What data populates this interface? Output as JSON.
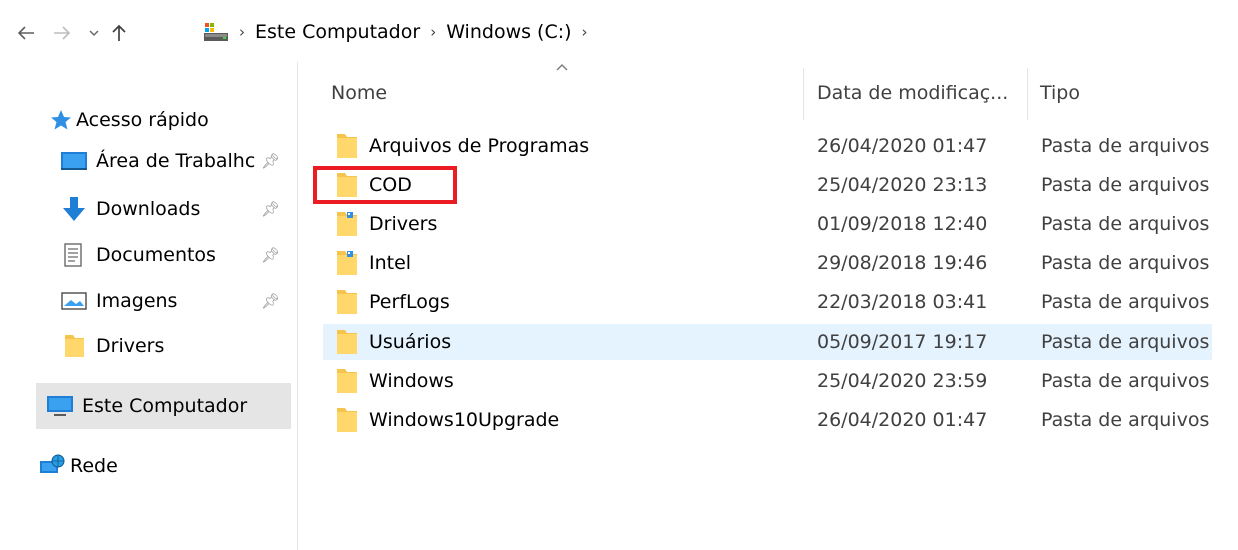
{
  "toolbar": {
    "back_icon": "arrow-left-icon",
    "forward_icon": "arrow-right-icon",
    "recent_icon": "chevron-down-icon",
    "up_icon": "arrow-up-icon"
  },
  "breadcrumb": {
    "root_icon": "computer-drive-icon",
    "items": [
      "Este Computador",
      "Windows (C:)"
    ],
    "separator": "›"
  },
  "sidebar": {
    "quick_access": "Acesso rápido",
    "items": [
      {
        "label": "Área de Trabalhc",
        "icon": "desktop-icon",
        "pinned": true
      },
      {
        "label": "Downloads",
        "icon": "download-arrow-icon",
        "pinned": true
      },
      {
        "label": "Documentos",
        "icon": "document-icon",
        "pinned": true
      },
      {
        "label": "Imagens",
        "icon": "pictures-icon",
        "pinned": true
      },
      {
        "label": "Drivers",
        "icon": "folder-icon",
        "pinned": false
      }
    ],
    "this_pc": "Este Computador",
    "network": "Rede"
  },
  "columns": {
    "name": "Nome",
    "date": "Data de modificaç...",
    "type": "Tipo",
    "sort_indicator": "^"
  },
  "files": [
    {
      "name": "Arquivos de Programas",
      "date": "26/04/2020 01:47",
      "type": "Pasta de arquivos"
    },
    {
      "name": "COD",
      "date": "25/04/2020 23:13",
      "type": "Pasta de arquivos"
    },
    {
      "name": "Drivers",
      "date": "01/09/2018 12:40",
      "type": "Pasta de arquivos"
    },
    {
      "name": "Intel",
      "date": "29/08/2018 19:46",
      "type": "Pasta de arquivos"
    },
    {
      "name": "PerfLogs",
      "date": "22/03/2018 03:41",
      "type": "Pasta de arquivos"
    },
    {
      "name": "Usuários",
      "date": "05/09/2017 19:17",
      "type": "Pasta de arquivos"
    },
    {
      "name": "Windows",
      "date": "25/04/2020 23:59",
      "type": "Pasta de arquivos"
    },
    {
      "name": "Windows10Upgrade",
      "date": "26/04/2020 01:47",
      "type": "Pasta de arquivos"
    }
  ],
  "colors": {
    "highlight_box": "#ec1c24",
    "hover_row": "#e5f3ff",
    "selected_nav": "#e5e5e5",
    "folder_yellow": "#ffd76b"
  }
}
